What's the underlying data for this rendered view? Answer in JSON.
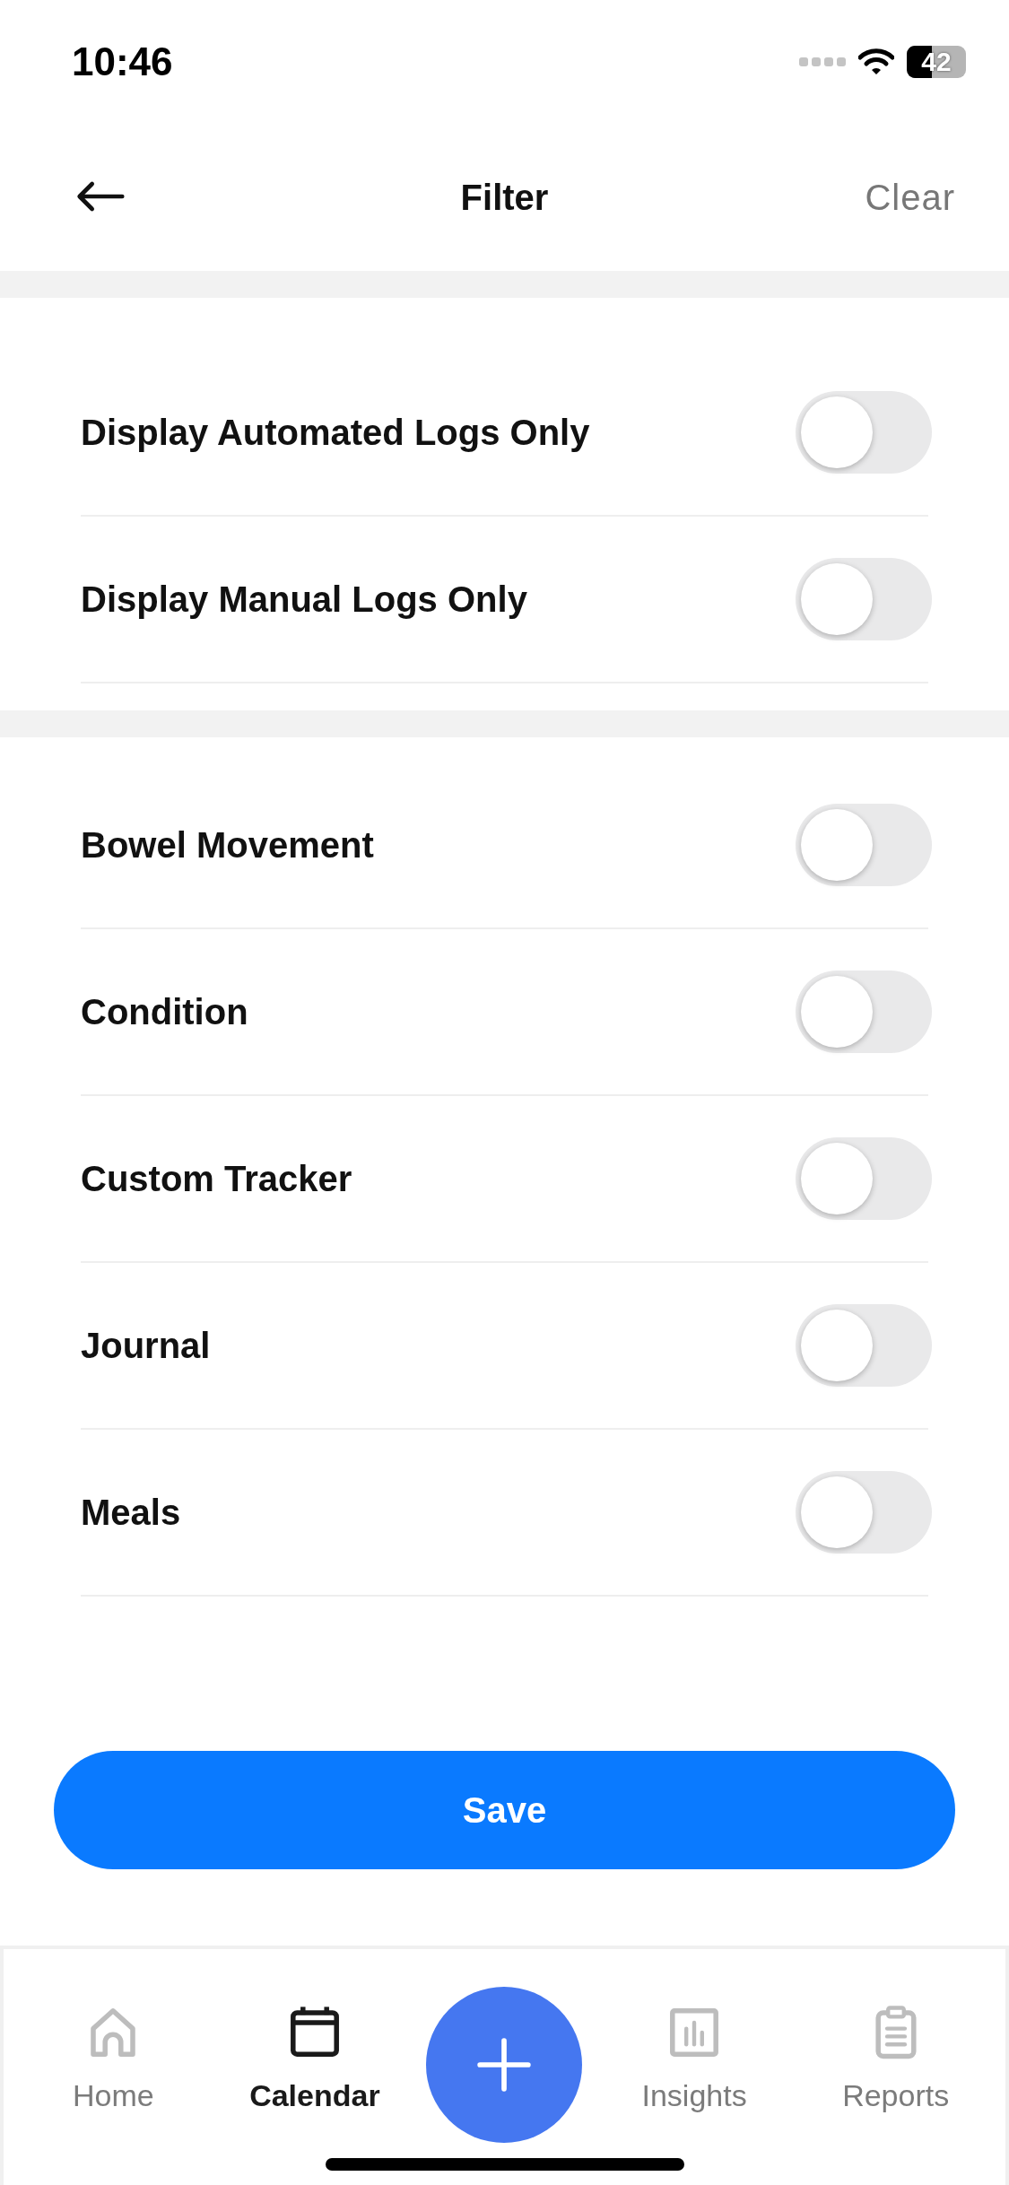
{
  "status_bar": {
    "time": "10:46",
    "battery": "42"
  },
  "header": {
    "title": "Filter",
    "action": "Clear"
  },
  "sections": [
    {
      "items": [
        {
          "label": "Display Automated Logs Only",
          "on": false
        },
        {
          "label": "Display Manual Logs Only",
          "on": false
        }
      ]
    },
    {
      "items": [
        {
          "label": "Bowel Movement",
          "on": false
        },
        {
          "label": "Condition",
          "on": false
        },
        {
          "label": "Custom Tracker",
          "on": false
        },
        {
          "label": "Journal",
          "on": false
        },
        {
          "label": "Meals",
          "on": false
        }
      ]
    }
  ],
  "save_button": "Save",
  "tab_bar": [
    {
      "label": "Home",
      "selected": false
    },
    {
      "label": "Calendar",
      "selected": true
    },
    {
      "label": "Insights",
      "selected": false
    },
    {
      "label": "Reports",
      "selected": false
    }
  ]
}
